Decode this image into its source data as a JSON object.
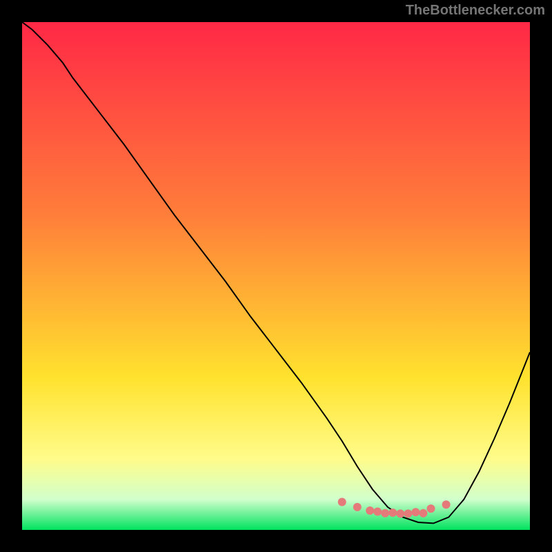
{
  "watermark": "TheBottlenecker.com",
  "chart_data": {
    "type": "line",
    "title": "",
    "xlabel": "",
    "ylabel": "",
    "xlim": [
      0,
      1
    ],
    "ylim": [
      0,
      1
    ],
    "background_gradient": {
      "top": "#ff2846",
      "mid1": "#ff7e3a",
      "mid2": "#ffe22e",
      "mid3": "#fffc8a",
      "mid4": "#d1ffcc",
      "bottom": "#00e25e"
    },
    "series": [
      {
        "name": "curve",
        "color": "#000000",
        "stroke_width": 2,
        "x": [
          0.0,
          0.02,
          0.05,
          0.08,
          0.1,
          0.15,
          0.2,
          0.25,
          0.3,
          0.35,
          0.4,
          0.45,
          0.5,
          0.55,
          0.6,
          0.63,
          0.66,
          0.69,
          0.72,
          0.75,
          0.78,
          0.81,
          0.84,
          0.87,
          0.9,
          0.93,
          0.96,
          1.0
        ],
        "y": [
          1.0,
          0.985,
          0.955,
          0.92,
          0.89,
          0.825,
          0.76,
          0.69,
          0.62,
          0.555,
          0.49,
          0.42,
          0.355,
          0.29,
          0.22,
          0.175,
          0.125,
          0.08,
          0.045,
          0.025,
          0.015,
          0.013,
          0.025,
          0.06,
          0.115,
          0.18,
          0.25,
          0.35
        ]
      }
    ],
    "markers": {
      "name": "dots",
      "color": "#e57a7a",
      "radius": 6,
      "x": [
        0.63,
        0.66,
        0.685,
        0.7,
        0.715,
        0.73,
        0.745,
        0.76,
        0.775,
        0.79,
        0.805,
        0.835
      ],
      "y": [
        0.055,
        0.045,
        0.038,
        0.036,
        0.033,
        0.034,
        0.032,
        0.032,
        0.035,
        0.033,
        0.042,
        0.05
      ]
    }
  }
}
